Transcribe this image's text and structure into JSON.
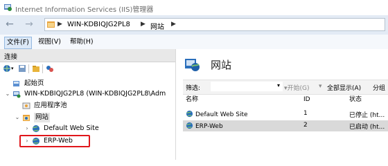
{
  "window": {
    "title": "Internet Information Services (IIS)管理器"
  },
  "address": {
    "segments": [
      "WIN-KDBIQJG2PL8",
      "网站"
    ]
  },
  "menus": [
    {
      "label": "文件(F)",
      "active": true
    },
    {
      "label": "视图(V)",
      "active": false
    },
    {
      "label": "帮助(H)",
      "active": false
    }
  ],
  "connections": {
    "header": "连接",
    "tree": [
      {
        "label": "起始页",
        "level": 0,
        "icon": "start-page-icon"
      },
      {
        "label": "WIN-KDBIQJG2PL8 (WIN-KDBIQJG2PL8\\Adm",
        "level": 0,
        "expanded": true,
        "icon": "server-icon"
      },
      {
        "label": "应用程序池",
        "level": 1,
        "icon": "app-pool-icon"
      },
      {
        "label": "网站",
        "level": 1,
        "expanded": true,
        "icon": "sites-folder-icon"
      },
      {
        "label": "Default Web Site",
        "level": 2,
        "collapsed": true,
        "icon": "globe-icon"
      },
      {
        "label": "ERP-Web",
        "level": 2,
        "collapsed": true,
        "icon": "globe-icon",
        "highlighted": true
      }
    ]
  },
  "main": {
    "title": "网站",
    "filter": {
      "label": "筛选:",
      "start_label": "开始(G)",
      "show_all_label": "全部显示(A)",
      "group_label": "分组"
    },
    "columns": [
      "名称",
      "ID",
      "状态"
    ],
    "rows": [
      {
        "name": "Default Web Site",
        "id": "1",
        "status": "已停止 (ht...",
        "selected": false
      },
      {
        "name": "ERP-Web",
        "id": "2",
        "status": "已启动 (ht...",
        "selected": true
      }
    ]
  },
  "colors": {
    "addressbar_bg": "#e3ebf5",
    "callout_red": "#e0161b",
    "selected_row": "#d9d9d9"
  }
}
